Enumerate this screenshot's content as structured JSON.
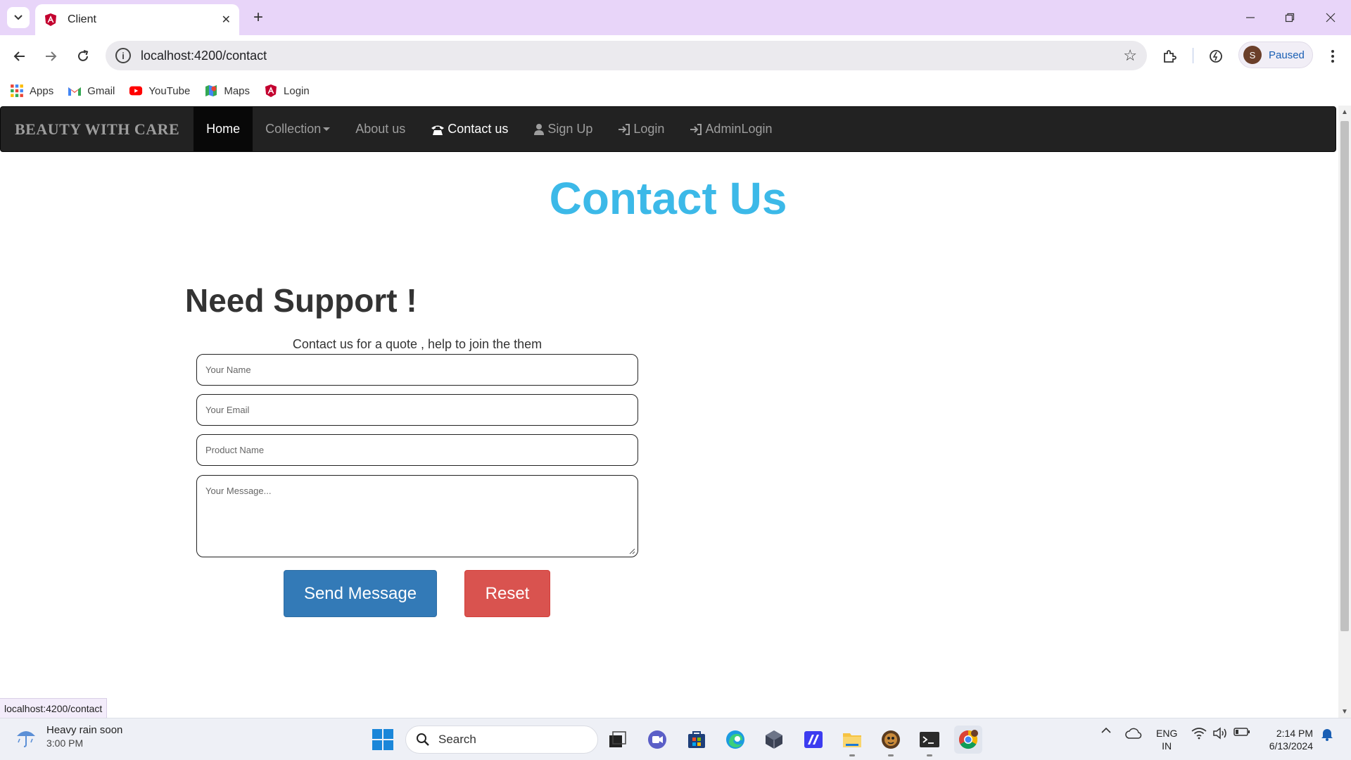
{
  "browser": {
    "tab_title": "Client",
    "url": "localhost:4200/contact",
    "profile_initial": "S",
    "profile_status": "Paused",
    "bookmarks": [
      "Apps",
      "Gmail",
      "YouTube",
      "Maps",
      "Login"
    ],
    "status_url": "localhost:4200/contact"
  },
  "site": {
    "brand": "BEAUTY WITH CARE",
    "nav": {
      "home": "Home",
      "collection": "Collection",
      "about": "About us",
      "contact": "Contact us",
      "signup": "Sign Up",
      "login": "Login",
      "adminlogin": "AdminLogin"
    }
  },
  "contact": {
    "title": "Contact Us",
    "heading": "Need Support !",
    "subtitle": "Contact us for a quote , help to join the them",
    "fields": {
      "name_placeholder": "Your Name",
      "email_placeholder": "Your Email",
      "product_placeholder": "Product Name",
      "message_placeholder": "Your Message..."
    },
    "send_label": "Send Message",
    "reset_label": "Reset"
  },
  "taskbar": {
    "weather_main": "Heavy rain soon",
    "weather_time": "3:00 PM",
    "search_label": "Search",
    "lang_top": "ENG",
    "lang_bottom": "IN",
    "time": "2:14 PM",
    "date": "6/13/2024"
  },
  "colors": {
    "tabstrip": "#e8d5f9",
    "navbar": "#222222",
    "title_accent": "#3cb9e8",
    "send_button": "#337ab7",
    "reset_button": "#d9534f"
  }
}
